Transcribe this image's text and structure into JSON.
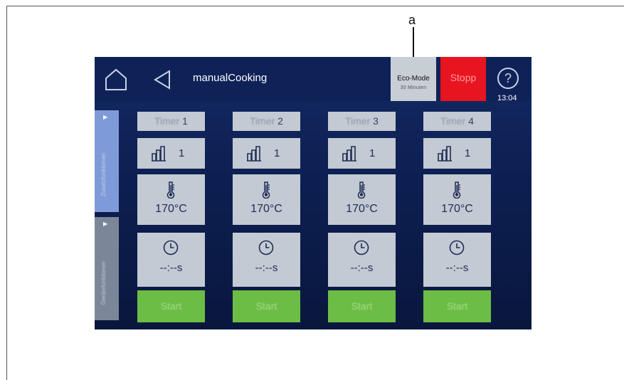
{
  "callout": {
    "letter": "a"
  },
  "header": {
    "title": "manualCooking",
    "eco_mode": {
      "label": "Eco-Mode",
      "value": "30",
      "unit": "Minuten"
    },
    "stop_label": "Stopp",
    "help_symbol": "?",
    "time": "13:04"
  },
  "sidebar": {
    "tabs": [
      {
        "label": "Zusatzfunktionen"
      },
      {
        "label": "Gerätefunktionen"
      }
    ]
  },
  "timers": [
    {
      "name_word": "Timer",
      "number": "1",
      "level": "1",
      "temperature": "170°C",
      "time": "--:--s",
      "start_label": "Start"
    },
    {
      "name_word": "Timer",
      "number": "2",
      "level": "1",
      "temperature": "170°C",
      "time": "--:--s",
      "start_label": "Start"
    },
    {
      "name_word": "Timer",
      "number": "3",
      "level": "1",
      "temperature": "170°C",
      "time": "--:--s",
      "start_label": "Start"
    },
    {
      "name_word": "Timer",
      "number": "4",
      "level": "1",
      "temperature": "170°C",
      "time": "--:--s",
      "start_label": "Start"
    }
  ],
  "icons": {
    "home": "home-icon",
    "back": "back-arrow-icon",
    "help": "help-icon",
    "level": "level-bars-icon",
    "temperature": "thermometer-icon",
    "time": "clock-icon"
  },
  "colors": {
    "stop": "#e8141f",
    "start": "#6cbd45",
    "tile": "#c3cad3",
    "screen_bg": "#0f2258"
  }
}
